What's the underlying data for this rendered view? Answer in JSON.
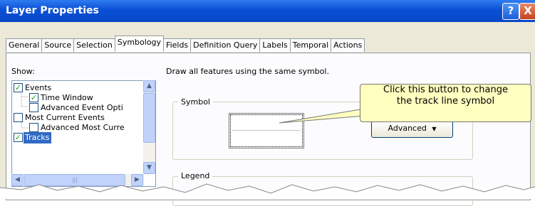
{
  "window": {
    "title": "Layer Properties",
    "help_glyph": "?",
    "close_glyph": "X"
  },
  "tabs": [
    {
      "label": "General"
    },
    {
      "label": "Source"
    },
    {
      "label": "Selection"
    },
    {
      "label": "Symbology"
    },
    {
      "label": "Fields"
    },
    {
      "label": "Definition Query"
    },
    {
      "label": "Labels"
    },
    {
      "label": "Temporal"
    },
    {
      "label": "Actions"
    }
  ],
  "show": {
    "label": "Show:",
    "items": [
      {
        "label": "Events",
        "checked": true
      },
      {
        "label": "Time Window",
        "checked": true
      },
      {
        "label": "Advanced Event Opti",
        "checked": false
      },
      {
        "label": "Most Current Events",
        "checked": false
      },
      {
        "label": "Advanced Most Curre",
        "checked": false
      },
      {
        "label": "Tracks",
        "checked": true
      }
    ]
  },
  "main": {
    "description": "Draw all features using the same symbol.",
    "symbol_group": "Symbol",
    "advanced_button": "Advanced",
    "legend_group": "Legend"
  },
  "callout": {
    "line1": "Click this button to change",
    "line2": "the track line symbol"
  },
  "colors": {
    "titlebar": "#0a4fd6",
    "selection": "#316ac5",
    "callout": "#ffffc0"
  }
}
